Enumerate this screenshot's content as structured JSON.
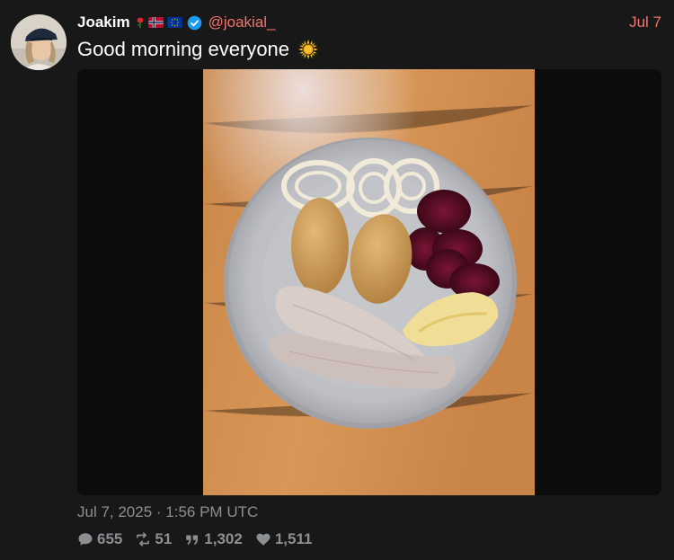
{
  "tweet": {
    "author": {
      "display_name": "Joakim",
      "handle": "@joakial_",
      "badges": [
        "rose-icon",
        "norway-flag-icon",
        "eu-flag-icon",
        "verified-badge-icon"
      ]
    },
    "date_short": "Jul 7",
    "text": "Good morning everyone",
    "text_emoji": "sun-icon",
    "timestamp": "Jul 7, 2025 · 1:56 PM UTC",
    "stats": {
      "replies": "655",
      "retweets": "51",
      "quotes": "1,302",
      "likes": "1,511"
    }
  },
  "colors": {
    "background": "#181818",
    "accent": "#f4736c",
    "muted": "#8b8f93",
    "verified": "#1d9bf0"
  }
}
